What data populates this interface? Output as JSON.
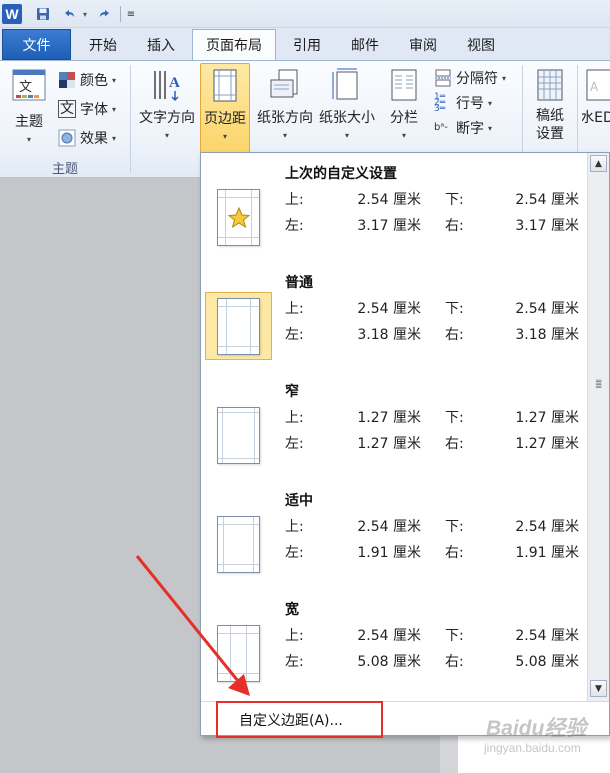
{
  "quick_access": {
    "app_icon_letter": "W",
    "save_icon": "save-icon",
    "undo_icon": "undo-icon",
    "redo_icon": "redo-icon",
    "customize_icon": "customize-qat-icon"
  },
  "tabs": [
    {
      "label": "文件",
      "active": false
    },
    {
      "label": "开始",
      "active": false
    },
    {
      "label": "插入",
      "active": false
    },
    {
      "label": "页面布局",
      "active": true
    },
    {
      "label": "引用",
      "active": false
    },
    {
      "label": "邮件",
      "active": false
    },
    {
      "label": "审阅",
      "active": false
    },
    {
      "label": "视图",
      "active": false
    }
  ],
  "ribbon": {
    "theme_group": {
      "themes_label": "主题",
      "colors_label": "颜色",
      "fonts_label": "字体",
      "effects_label": "效果",
      "group_label": "主题",
      "fonts_icon_glyph": "文"
    },
    "page_setup": {
      "text_direction": "文字方向",
      "margins": "页边距",
      "orientation": "纸张方向",
      "size": "纸张大小",
      "columns": "分栏",
      "breaks": "分隔符",
      "line_numbers": "行号",
      "hyphenation": "断字"
    },
    "manuscript": "稿纸\n设置",
    "watermark_partial": "水ED"
  },
  "margins_menu": {
    "options": [
      {
        "name": "上次的自定义设置",
        "top_label": "上:",
        "top": "2.54 厘米",
        "bottom_label": "下:",
        "bottom": "2.54 厘米",
        "left_label": "左:",
        "left": "3.17 厘米",
        "right_label": "右:",
        "right": "3.17 厘米",
        "icon": "page-star-icon",
        "selected": false
      },
      {
        "name": "普通",
        "top_label": "上:",
        "top": "2.54 厘米",
        "bottom_label": "下:",
        "bottom": "2.54 厘米",
        "left_label": "左:",
        "left": "3.18 厘米",
        "right_label": "右:",
        "right": "3.18 厘米",
        "icon": "page-normal-icon",
        "selected": true
      },
      {
        "name": "窄",
        "top_label": "上:",
        "top": "1.27 厘米",
        "bottom_label": "下:",
        "bottom": "1.27 厘米",
        "left_label": "左:",
        "left": "1.27 厘米",
        "right_label": "右:",
        "right": "1.27 厘米",
        "icon": "page-narrow-icon",
        "selected": false
      },
      {
        "name": "适中",
        "top_label": "上:",
        "top": "2.54 厘米",
        "bottom_label": "下:",
        "bottom": "2.54 厘米",
        "left_label": "左:",
        "left": "1.91 厘米",
        "right_label": "右:",
        "right": "1.91 厘米",
        "icon": "page-moderate-icon",
        "selected": false
      },
      {
        "name": "宽",
        "top_label": "上:",
        "top": "2.54 厘米",
        "bottom_label": "下:",
        "bottom": "2.54 厘米",
        "left_label": "左:",
        "left": "5.08 厘米",
        "right_label": "右:",
        "right": "5.08 厘米",
        "icon": "page-wide-icon",
        "selected": false
      }
    ],
    "custom_label": "自定义边距(A)..."
  },
  "annotation": {
    "color": "#e5302a"
  },
  "watermark": {
    "main": "Baidu经验",
    "sub": "jingyan.baidu.com"
  },
  "colors": {
    "accent_file_tab": "#2b6cc4",
    "selection_fill": "#fde9a6",
    "selection_border": "#e4b050"
  }
}
